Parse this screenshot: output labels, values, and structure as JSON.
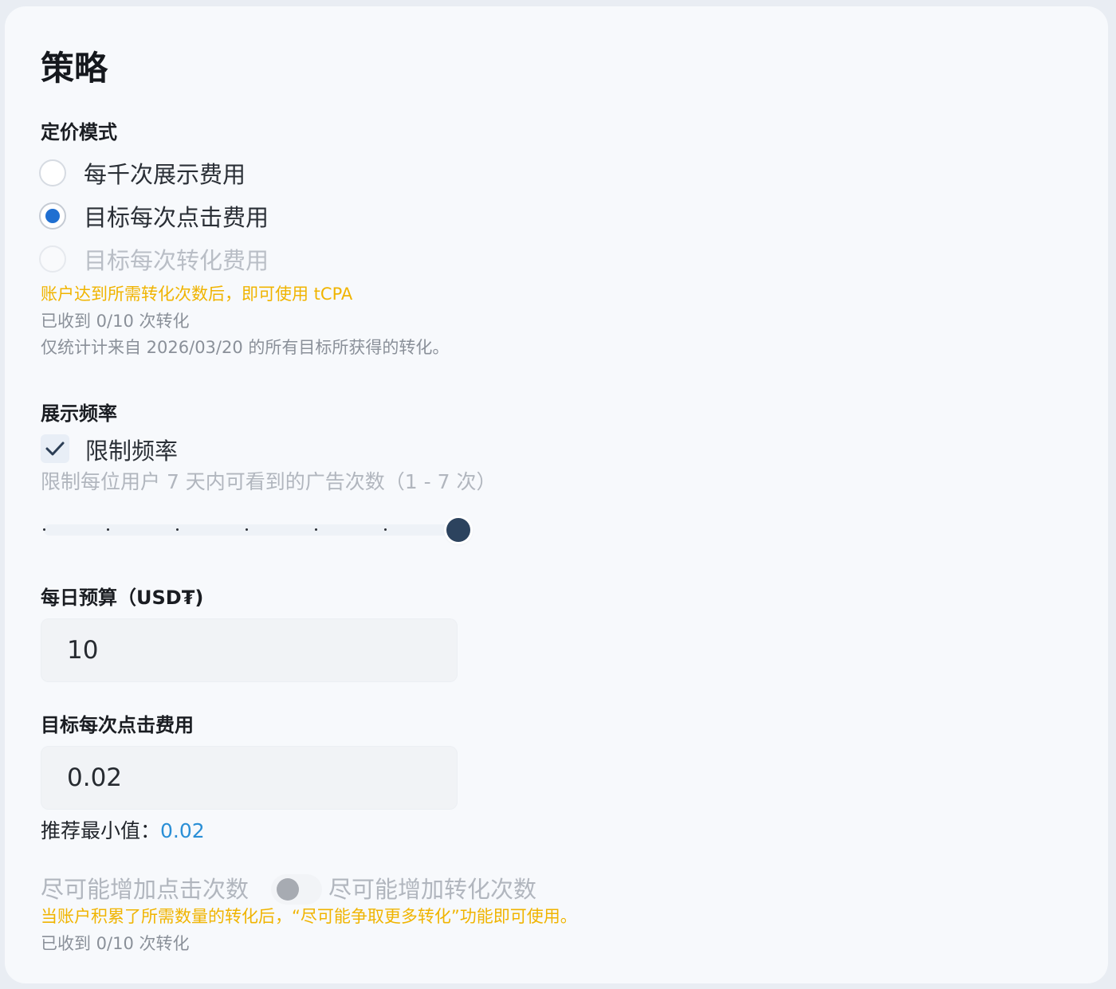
{
  "strategy": {
    "title": "策略"
  },
  "pricing": {
    "label": "定价模式",
    "options": [
      {
        "label": "每千次展示费用",
        "state": "unchecked"
      },
      {
        "label": "目标每次点击费用",
        "state": "checked"
      },
      {
        "label": "目标每次转化费用",
        "state": "disabled"
      }
    ],
    "tcpa_warning": "账户达到所需转化次数后，即可使用 tCPA",
    "conversions_received": "已收到 0/10 次转化",
    "stats_note": "仅统计计来自 2026/03/20 的所有目标所获得的转化。"
  },
  "frequency": {
    "label": "展示频率",
    "checkbox_label": "限制频率",
    "checkbox_checked": true,
    "description": "限制每位用户 7 天内可看到的广告次数（1 - 7 次）",
    "slider": {
      "min": 1,
      "max": 7,
      "value": 7
    }
  },
  "daily_budget": {
    "label": "每日预算（USD₮)",
    "value": "10"
  },
  "target_cpc": {
    "label": "目标每次点击费用",
    "value": "0.02",
    "hint_label": "推荐最小值：",
    "hint_value": "0.02"
  },
  "optimization": {
    "left_label": "尽可能增加点击次数",
    "right_label": "尽可能增加转化次数",
    "toggle_on": false,
    "warning": "当账户积累了所需数量的转化后，“尽可能争取更多转化”功能即可使用。",
    "conversions_received": "已收到 0/10 次转化"
  },
  "colors": {
    "accent": "#1f6fd1",
    "warning": "#f0b400",
    "link_value": "#2a8fd6",
    "slider_thumb": "#2c435e"
  }
}
